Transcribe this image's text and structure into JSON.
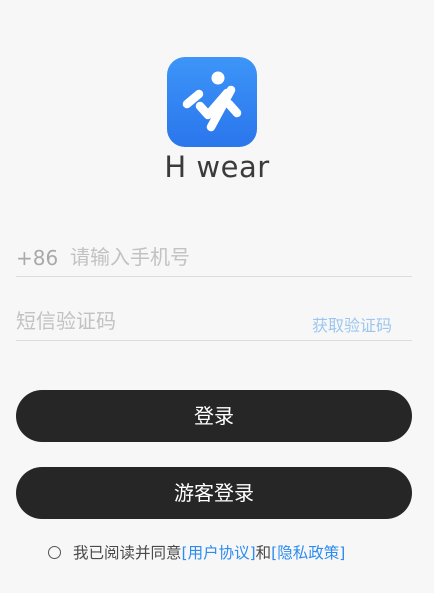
{
  "app": {
    "name": "H wear",
    "brand_color": "#2f80ed"
  },
  "login_form": {
    "country_code": "+86",
    "phone_placeholder": "请输入手机号",
    "code_placeholder": "短信验证码",
    "get_code_label": "获取验证码",
    "login_label": "登录",
    "guest_login_label": "游客登录"
  },
  "agreement": {
    "prefix": "我已阅读并同意",
    "user_agreement": "[用户协议]",
    "connector": "和",
    "privacy_policy": "[隐私政策]"
  },
  "icons": {
    "logo": "running-figure-icon",
    "checkbox": "radio-circle-icon"
  }
}
